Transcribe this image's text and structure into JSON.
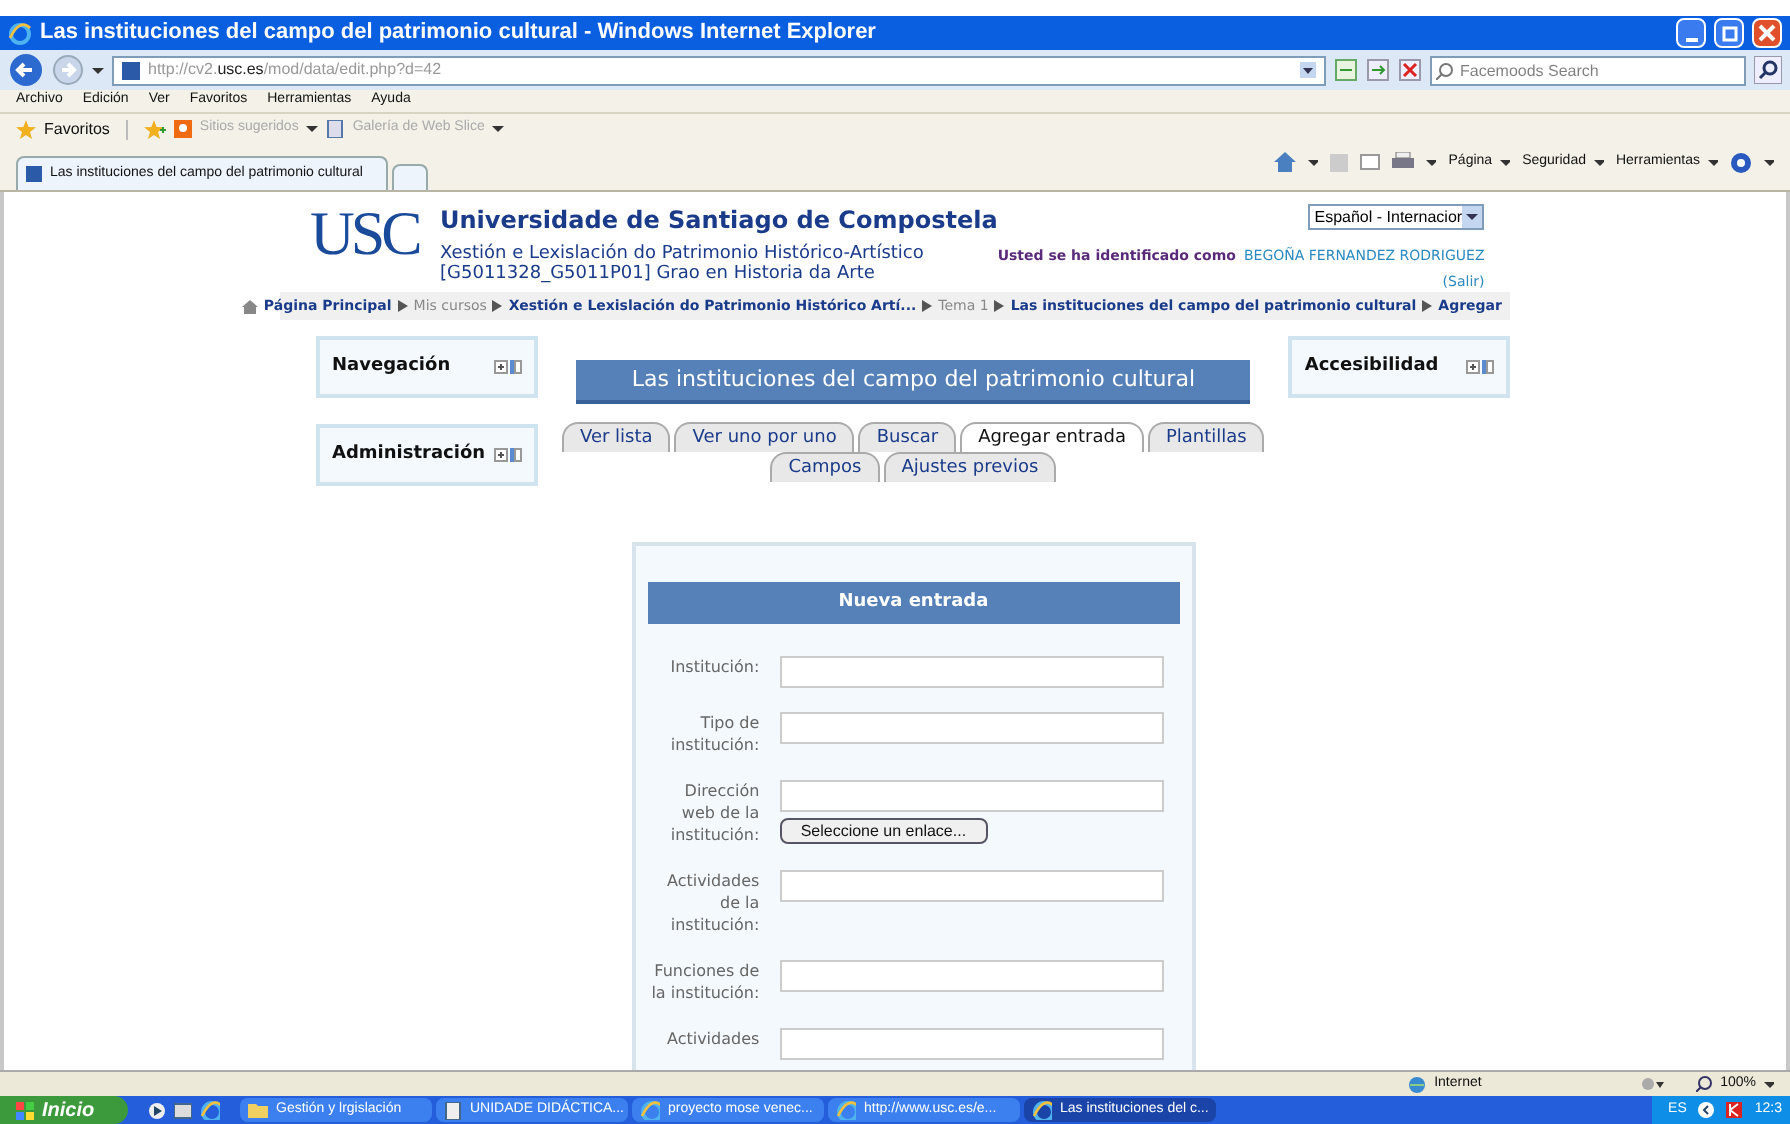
{
  "window": {
    "title": "Las instituciones del campo del patrimonio cultural - Windows Internet Explorer"
  },
  "address_bar": {
    "url_prefix": "http://cv2.",
    "url_host": "usc.es",
    "url_path": "/mod/data/edit.php?d=42",
    "search_placeholder": "Facemoods Search"
  },
  "menu": [
    "Archivo",
    "Edición",
    "Ver",
    "Favoritos",
    "Herramientas",
    "Ayuda"
  ],
  "favorites_bar": {
    "label": "Favoritos",
    "items": [
      {
        "label": "Sitios sugeridos",
        "disabled": true
      },
      {
        "label": "Galería de Web Slice",
        "disabled": true
      }
    ]
  },
  "browser_tabs": [
    {
      "label": "Las instituciones del campo del patrimonio cultural",
      "selected": true
    }
  ],
  "command_bar": [
    "Página",
    "Seguridad",
    "Herramientas"
  ],
  "page": {
    "header": {
      "logo": "USC",
      "university": "Universidade de Santiago de Compostela",
      "course_lines": [
        "Xestión e Lexislación do Patrimonio Histórico-Artístico",
        "[G5011328_G5011P01] Grao en Historia da Arte"
      ],
      "language": "Español - Internacior",
      "login_prefix": "Usted se ha identificado como",
      "user": "BEGOÑA FERNANDEZ RODRIGUEZ",
      "logout": "(Salir)"
    },
    "breadcrumb": [
      {
        "label": "Página Principal",
        "kind": "link"
      },
      {
        "label": "Mis cursos",
        "kind": "plain"
      },
      {
        "label": "Xestión e Lexislación do Patrimonio Histórico Artí...",
        "kind": "link"
      },
      {
        "label": "Tema 1",
        "kind": "plain"
      },
      {
        "label": "Las instituciones del campo del patrimonio cultural",
        "kind": "link"
      },
      {
        "label": "Agregar",
        "kind": "link"
      }
    ],
    "left_blocks": [
      "Navegación",
      "Administración"
    ],
    "right_blocks": [
      "Accesibilidad"
    ],
    "activity_title": "Las instituciones del campo del patrimonio cultural",
    "tab_rows": [
      [
        {
          "label": "Ver lista",
          "selected": false
        },
        {
          "label": "Ver uno por uno",
          "selected": false
        },
        {
          "label": "Buscar",
          "selected": false
        },
        {
          "label": "Agregar entrada",
          "selected": true
        },
        {
          "label": "Plantillas",
          "selected": false
        }
      ],
      [
        {
          "label": "Campos",
          "selected": false
        },
        {
          "label": "Ajustes previos",
          "selected": false
        }
      ]
    ],
    "form": {
      "title": "Nueva entrada",
      "fields": [
        {
          "label": "Institución:",
          "kind": "text"
        },
        {
          "label": "Tipo de institución:",
          "kind": "text"
        },
        {
          "label": "Dirección web de la institución:",
          "kind": "url",
          "button": "Seleccione un enlace..."
        },
        {
          "label": "Actividades de la institución:",
          "kind": "text"
        },
        {
          "label": "Funciones de la institución:",
          "kind": "text"
        },
        {
          "label": "Actividades",
          "kind": "text"
        }
      ]
    }
  },
  "status_bar": {
    "zone": "Internet",
    "zoom": "100%"
  },
  "taskbar": {
    "start": "Inicio",
    "tasks": [
      {
        "label": "Gestión y lrgislación",
        "kind": "folder",
        "selected": false
      },
      {
        "label": "UNIDADE DIDÁCTICA...",
        "kind": "document",
        "selected": false
      },
      {
        "label": "proyecto mose venec...",
        "kind": "browser",
        "selected": false
      },
      {
        "label": "http://www.usc.es/e...",
        "kind": "browser",
        "selected": false
      },
      {
        "label": "Las instituciones del c...",
        "kind": "browser",
        "selected": true
      }
    ],
    "language": "ES",
    "clock": "12:3"
  }
}
